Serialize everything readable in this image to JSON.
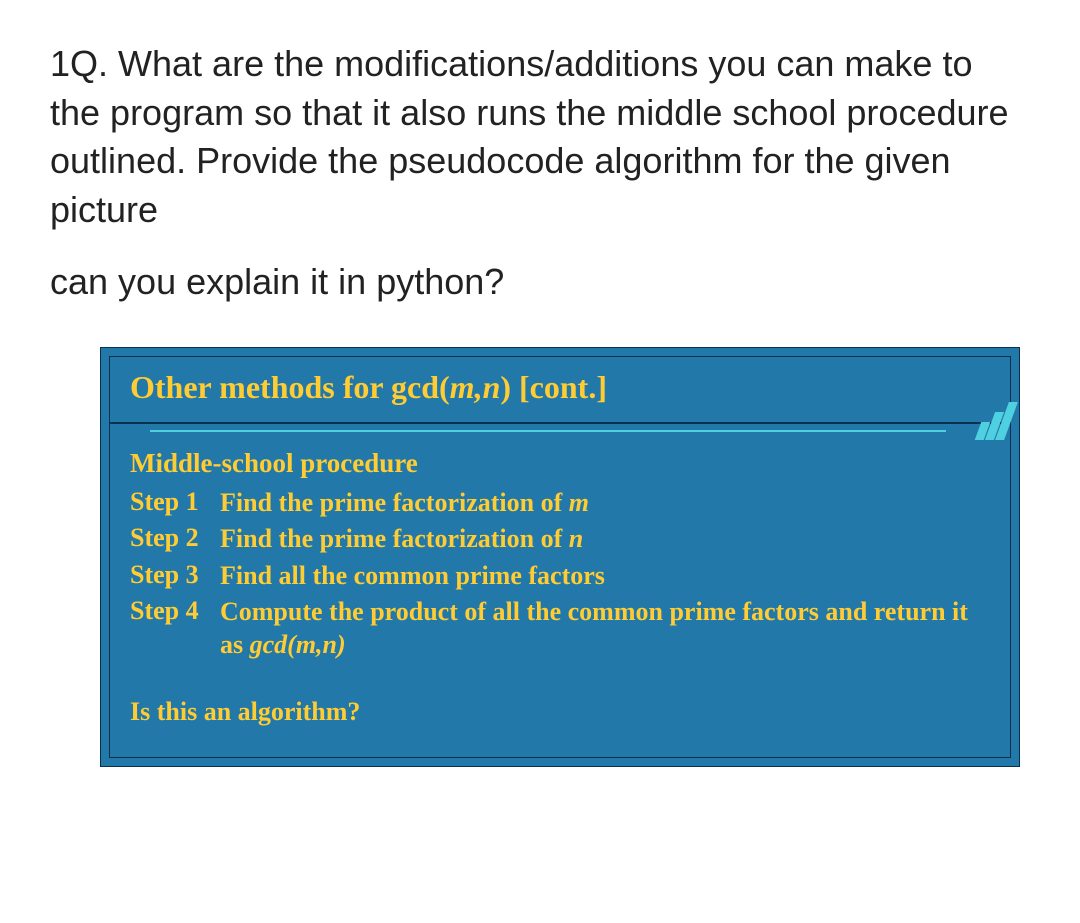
{
  "question": {
    "line1": "1Q. What are the modifications/additions you can make to the program so that it also runs the middle school procedure outlined. Provide the pseudocode algorithm for the given picture",
    "line2": "can you explain it in python?"
  },
  "slide": {
    "title_pre": "Other methods for gcd(",
    "title_mn": "m,n",
    "title_post": ") [cont.]",
    "subheading": "Middle-school procedure",
    "steps": [
      {
        "label": "Step 1",
        "text_pre": "Find the prime factorization of ",
        "text_italic": "m",
        "text_post": ""
      },
      {
        "label": "Step 2",
        "text_pre": "Find the prime factorization of ",
        "text_italic": "n",
        "text_post": ""
      },
      {
        "label": "Step 3",
        "text_pre": "Find all the common prime factors",
        "text_italic": "",
        "text_post": ""
      },
      {
        "label": "Step 4",
        "text_pre": "Compute the product of all the  common prime factors and return it as ",
        "text_italic": "gcd(m,n)",
        "text_post": ""
      }
    ],
    "bottom_question": "Is this an algorithm?"
  }
}
